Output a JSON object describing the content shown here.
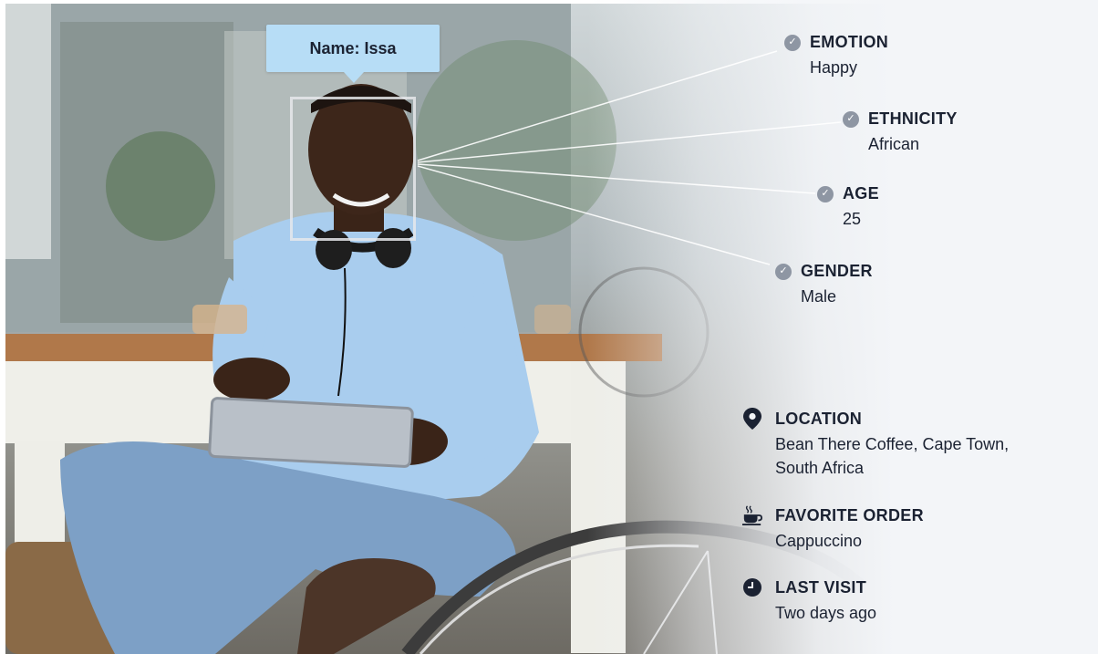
{
  "name_tag": {
    "text": "Name: Issa"
  },
  "attributes": [
    {
      "label": "EMOTION",
      "value": "Happy"
    },
    {
      "label": "ETHNICITY",
      "value": "African"
    },
    {
      "label": "AGE",
      "value": "25"
    },
    {
      "label": "GENDER",
      "value": "Male"
    }
  ],
  "info": [
    {
      "label": "LOCATION",
      "value": "Bean There Coffee, Cape Town, South Africa",
      "icon": "location-pin-icon"
    },
    {
      "label": "FAVORITE ORDER",
      "value": "Cappuccino",
      "icon": "coffee-cup-icon"
    },
    {
      "label": "LAST VISIT",
      "value": "Two days ago",
      "icon": "clock-icon"
    }
  ],
  "colors": {
    "name_tag_bg": "#b7ddf6",
    "text": "#1b2232",
    "check_badge": "#8e96a3",
    "panel_bg": "#f3f5f8"
  }
}
